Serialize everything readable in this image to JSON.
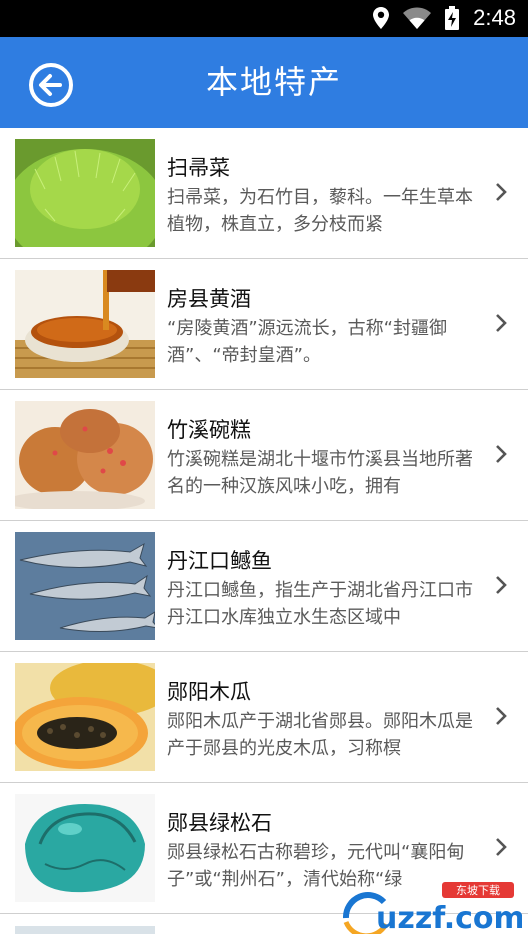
{
  "status_bar": {
    "time": "2:48"
  },
  "header": {
    "title": "本地特产"
  },
  "items": [
    {
      "title": "扫帚菜",
      "desc": "扫帚菜，为石竹目，藜科。一年生草本植物，株直立，多分枝而紧"
    },
    {
      "title": "房县黄酒",
      "desc": "“房陵黄酒”源远流长，古称“封疆御酒”、“帝封皇酒”。"
    },
    {
      "title": "竹溪碗糕",
      "desc": "竹溪碗糕是湖北十堰市竹溪县当地所著名的一种汉族风味小吃，拥有"
    },
    {
      "title": "丹江口鳡鱼",
      "desc": "丹江口鳡鱼，指生产于湖北省丹江口市丹江口水库独立水生态区域中"
    },
    {
      "title": "郧阳木瓜",
      "desc": "郧阳木瓜产于湖北省郧县。郧阳木瓜是产于郧县的光皮木瓜，习称榠"
    },
    {
      "title": "郧县绿松石",
      "desc": "郧县绿松石古称碧珍，元代叫“襄阳甸子”或“荆州石”，清代始称“绿"
    }
  ],
  "watermark": {
    "brand": "uzzf.com",
    "tag": "东坡下载"
  }
}
